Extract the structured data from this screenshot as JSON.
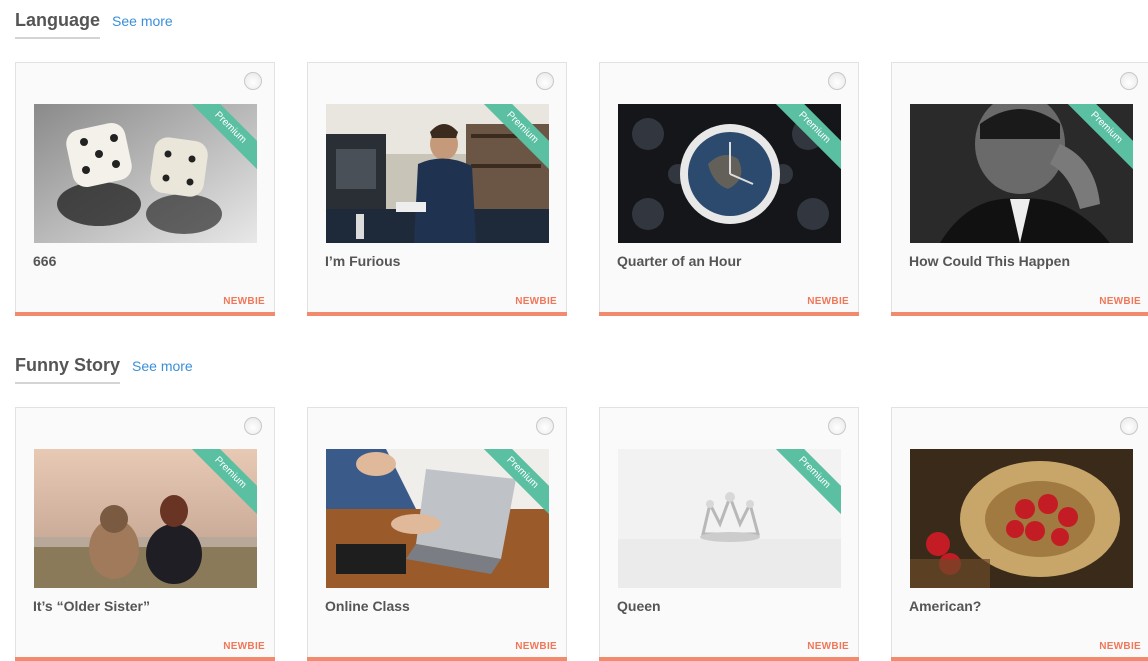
{
  "sections": [
    {
      "title": "Language",
      "see_more": "See more",
      "cards": [
        {
          "title": "666",
          "level": "NEWBIE",
          "premium": "Premium",
          "image": "dice"
        },
        {
          "title": "I’m Furious",
          "level": "NEWBIE",
          "premium": "Premium",
          "image": "barista"
        },
        {
          "title": "Quarter of an Hour",
          "level": "NEWBIE",
          "premium": "Premium",
          "image": "clock"
        },
        {
          "title": "How Could This Happen",
          "level": "NEWBIE",
          "premium": "Premium",
          "image": "crying-man"
        }
      ]
    },
    {
      "title": "Funny Story",
      "see_more": "See more",
      "cards": [
        {
          "title": "It’s “Older Sister”",
          "level": "NEWBIE",
          "premium": "Premium",
          "image": "girl-with-dog"
        },
        {
          "title": "Online Class",
          "level": "NEWBIE",
          "premium": "Premium",
          "image": "laptop"
        },
        {
          "title": "Queen",
          "level": "NEWBIE",
          "premium": "Premium",
          "image": "tiara"
        },
        {
          "title": "American?",
          "level": "NEWBIE",
          "image": "apples-in-hat"
        }
      ]
    }
  ],
  "colors": {
    "accent_link": "#3a8fd8",
    "level_text": "#f0785a",
    "card_bottom_bar": "#f28a6e",
    "premium_ribbon": "#5bbfa1"
  }
}
